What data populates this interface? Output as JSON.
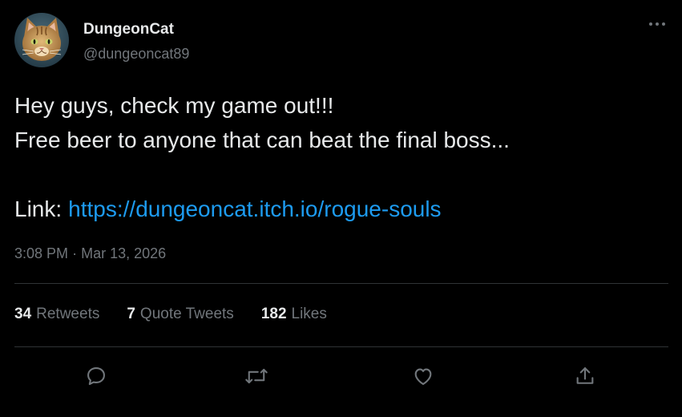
{
  "author": {
    "display_name": "DungeonCat",
    "handle": "@dungeoncat89",
    "avatar_icon": "cat-avatar"
  },
  "tweet": {
    "line1": "Hey guys, check my game out!!!",
    "line2": "Free beer to anyone that can beat the final boss...",
    "link_label": "Link:",
    "link_url": "https://dungeoncat.itch.io/rogue-souls",
    "time": "3:08 PM",
    "separator": "·",
    "date": "Mar 13, 2026"
  },
  "stats": {
    "retweets_count": "34",
    "retweets_label": "Retweets",
    "quotes_count": "7",
    "quotes_label": "Quote Tweets",
    "likes_count": "182",
    "likes_label": "Likes"
  },
  "actions": {
    "icons": [
      "reply-icon",
      "retweet-icon",
      "like-icon",
      "share-icon"
    ]
  },
  "colors": {
    "background": "#000000",
    "text": "#e7e9ea",
    "muted": "#71767b",
    "link": "#1d9bf0",
    "divider": "#2f3336"
  }
}
